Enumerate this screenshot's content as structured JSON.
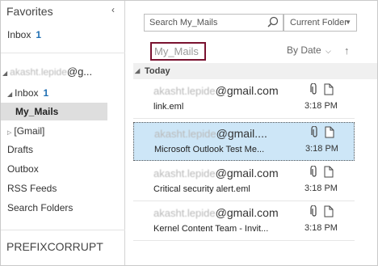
{
  "nav": {
    "favorites_title": "Favorites",
    "collapse_glyph": "‹",
    "inbox_label": "Inbox",
    "inbox_count": "1",
    "account_blurred": "akasht.lepide",
    "account_suffix": "@g...",
    "items": [
      {
        "label": "Inbox",
        "count": "1"
      },
      {
        "label": "My_Mails"
      },
      {
        "label": "[Gmail]"
      },
      {
        "label": "Drafts"
      },
      {
        "label": "Outbox"
      },
      {
        "label": "RSS Feeds"
      },
      {
        "label": "Search Folders"
      }
    ],
    "bottom_account": "PREFIXCORRUPT"
  },
  "list": {
    "search_placeholder": "Search My_Mails",
    "scope_label": "Current Folder",
    "folder_title": "My_Mails",
    "sort_label": "By Date",
    "sort_arrow": "↑",
    "group_label": "Today",
    "mails": [
      {
        "sender_blurred": "akasht.lepide",
        "sender_suffix": "@gmail.com",
        "subject": "link.eml",
        "time": "3:18 PM"
      },
      {
        "sender_blurred": "akasht.lepide",
        "sender_suffix": "@gmail....",
        "subject": "Microsoft Outlook Test Me...",
        "time": "3:18 PM"
      },
      {
        "sender_blurred": "akasht.lepide",
        "sender_suffix": "@gmail.com",
        "subject": "Critical security alert.eml",
        "time": "3:18 PM"
      },
      {
        "sender_blurred": "akasht.lepide",
        "sender_suffix": "@gmail.com",
        "subject": "Kernel Content Team - Invit...",
        "time": "3:18 PM"
      }
    ]
  },
  "colors": {
    "selected_bg": "#cde6f7",
    "count_blue": "#1f6fb3",
    "title_border": "#7a1230"
  }
}
